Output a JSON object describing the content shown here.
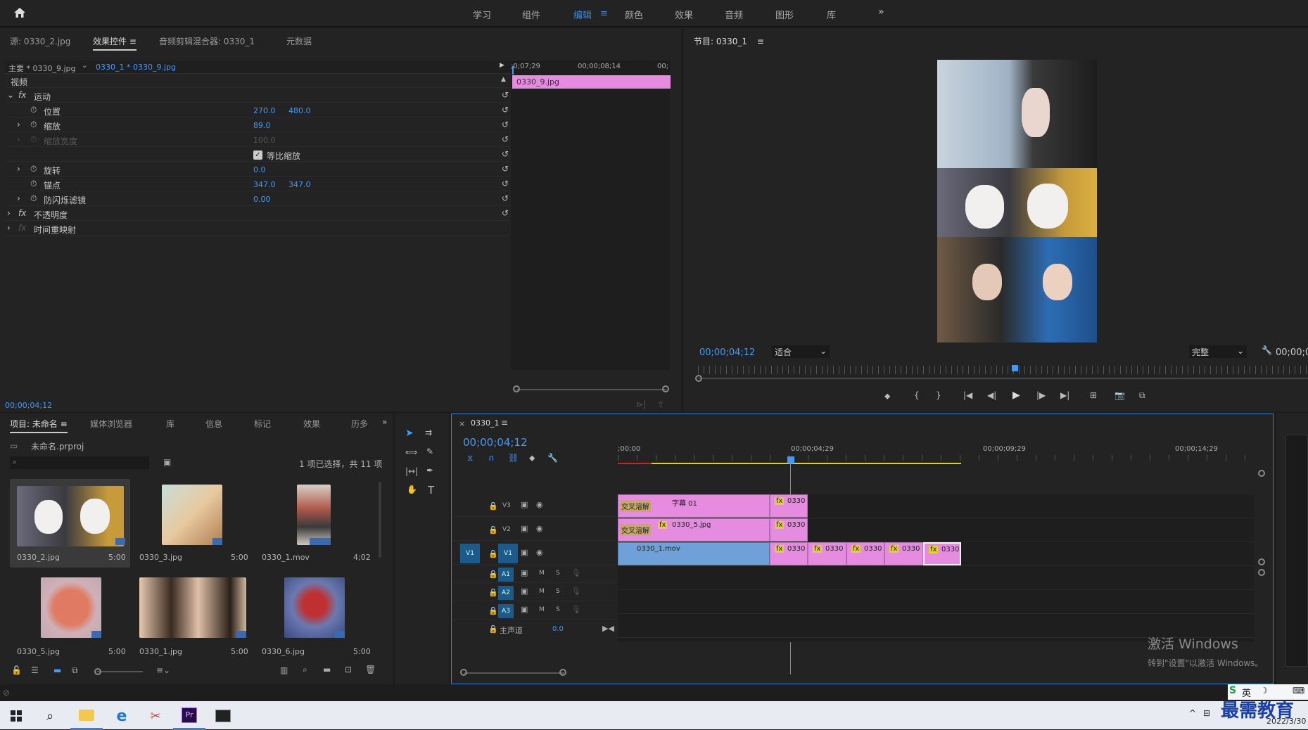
{
  "workspaces": [
    "学习",
    "组件",
    "编辑",
    "颜色",
    "效果",
    "音频",
    "图形",
    "库"
  ],
  "effects_panel": {
    "tabs": [
      "源: 0330_2.jpg",
      "效果控件",
      "音频剪辑混合器: 0330_1",
      "元数据"
    ],
    "master": "主要 * 0330_9.jpg",
    "clip": "0330_1 * 0330_9.jpg",
    "ruler": [
      ";0;07;29",
      "00;00;08;14",
      "00;"
    ],
    "clip_bar": "0330_9.jpg",
    "video_label": "视频",
    "rows": [
      {
        "name": "运动",
        "fx": true
      },
      {
        "name": "位置",
        "v1": "270.0",
        "v2": "480.0"
      },
      {
        "name": "缩放",
        "v1": "89.0"
      },
      {
        "name": "缩放宽度",
        "v1": "100.0",
        "disabled": true
      },
      {
        "name": "等比缩放",
        "checkbox": true
      },
      {
        "name": "旋转",
        "v1": "0.0"
      },
      {
        "name": "锚点",
        "v1": "347.0",
        "v2": "347.0"
      },
      {
        "name": "防闪烁滤镜",
        "v1": "0.00"
      },
      {
        "name": "不透明度",
        "fx": true
      },
      {
        "name": "时间重映射",
        "fx": true
      }
    ],
    "timecode": "00;00;04;12"
  },
  "program": {
    "title": "节目: 0330_1",
    "timecode": "00;00;04;12",
    "fit": "适合",
    "quality": "完整",
    "right_tc": "00;00;0"
  },
  "project": {
    "tabs": [
      "项目: 未命名",
      "媒体浏览器",
      "库",
      "信息",
      "标记",
      "效果",
      "历多"
    ],
    "file": "未命名.prproj",
    "selection": "1 项已选择，共 11 项",
    "items": [
      {
        "name": "0330_2.jpg",
        "dur": "5:00"
      },
      {
        "name": "0330_3.jpg",
        "dur": "5:00"
      },
      {
        "name": "0330_1.mov",
        "dur": "4;02"
      },
      {
        "name": "0330_5.jpg",
        "dur": "5:00"
      },
      {
        "name": "0330_1.jpg",
        "dur": "5:00"
      },
      {
        "name": "0330_6.jpg",
        "dur": "5:00"
      }
    ]
  },
  "timeline": {
    "title": "0330_1",
    "timecode": "00;00;04;12",
    "ruler": [
      ";00;00",
      "00;00;04;29",
      "00;00;09;29",
      "00;00;14;29"
    ],
    "tracks": [
      "V3",
      "V2",
      "V1",
      "A1",
      "A2",
      "A3"
    ],
    "master": "主声道",
    "master_val": "0.0",
    "clips": {
      "v3_trans": "交叉溶解",
      "v3_a": "字幕 01",
      "v3_b": "0330",
      "v2_trans": "交叉溶解",
      "v2_a": "0330_5.jpg",
      "v2_b": "0330",
      "v1_a": "0330_1.mov",
      "v1_b": "0330",
      "v1_c": "0330",
      "v1_d": "0330",
      "v1_e": "0330",
      "v1_f": "0330"
    },
    "ms": [
      "M",
      "S"
    ]
  },
  "watermark": {
    "line1": "激活 Windows",
    "line2": "转到\"设置\"以激活 Windows。"
  },
  "taskbar": {
    "ime": "英",
    "brand": "最需教育",
    "date": "2022/3/30"
  }
}
